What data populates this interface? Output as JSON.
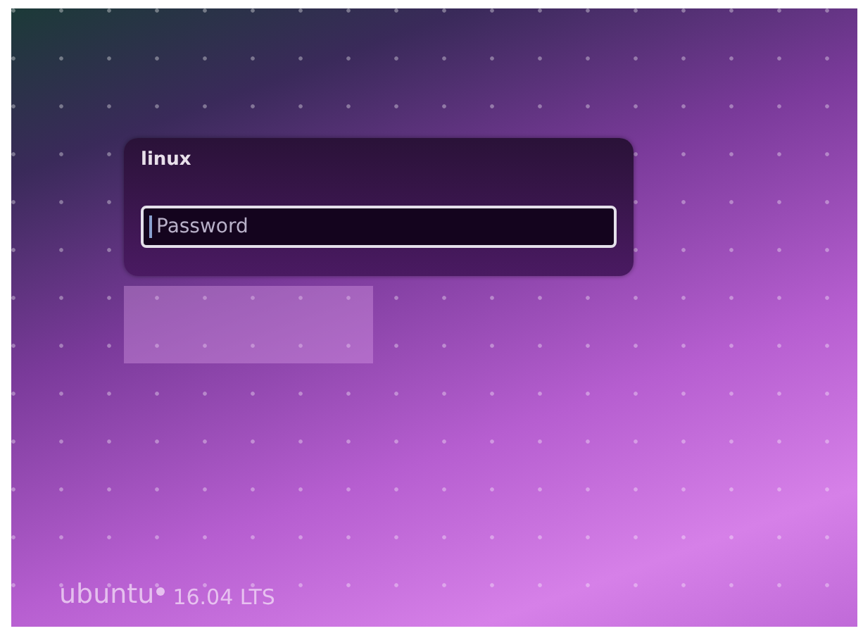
{
  "login": {
    "username": "linux",
    "password_field": {
      "placeholder": "Password",
      "focused": true
    }
  },
  "footer": {
    "brand": "ubuntu",
    "version": "16.04 LTS"
  }
}
